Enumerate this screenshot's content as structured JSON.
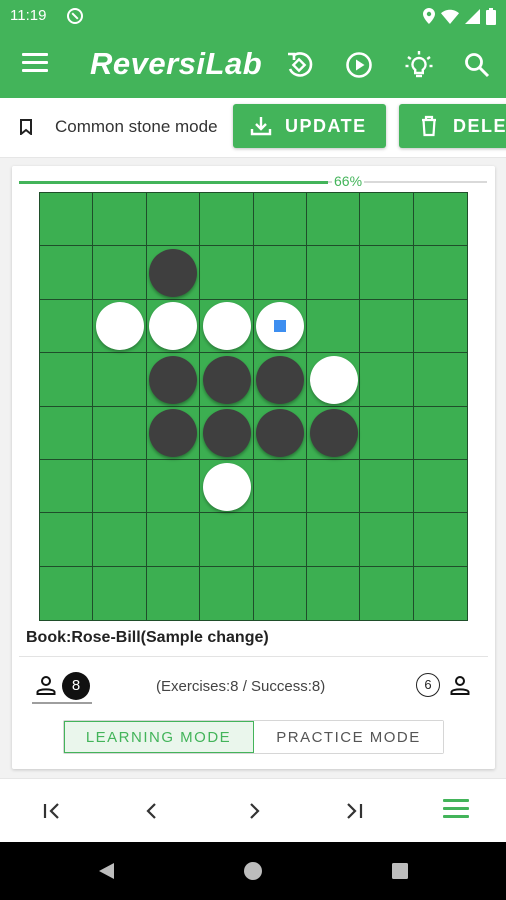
{
  "status_bar": {
    "time": "11:19"
  },
  "app_bar": {
    "title": "ReversiLab"
  },
  "action_row": {
    "mode_label": "Common stone mode",
    "update_label": "UPDATE",
    "delete_label": "DELETE"
  },
  "progress": {
    "value": 0.66,
    "label": "66%"
  },
  "board": {
    "size": 8,
    "stones": [
      {
        "row": 2,
        "col": 3,
        "color": "black"
      },
      {
        "row": 3,
        "col": 2,
        "color": "white"
      },
      {
        "row": 3,
        "col": 3,
        "color": "white"
      },
      {
        "row": 3,
        "col": 4,
        "color": "white"
      },
      {
        "row": 3,
        "col": 5,
        "color": "white",
        "marker": true
      },
      {
        "row": 4,
        "col": 3,
        "color": "black"
      },
      {
        "row": 4,
        "col": 4,
        "color": "black"
      },
      {
        "row": 4,
        "col": 5,
        "color": "black"
      },
      {
        "row": 4,
        "col": 6,
        "color": "white"
      },
      {
        "row": 5,
        "col": 3,
        "color": "black"
      },
      {
        "row": 5,
        "col": 4,
        "color": "black"
      },
      {
        "row": 5,
        "col": 5,
        "color": "black"
      },
      {
        "row": 5,
        "col": 6,
        "color": "black"
      },
      {
        "row": 6,
        "col": 4,
        "color": "white"
      }
    ]
  },
  "book": {
    "label": "Book:Rose-Bill(Sample change)"
  },
  "score": {
    "black_count": "8",
    "white_count": "6",
    "summary": "(Exercises:8 / Success:8)"
  },
  "modes": {
    "learning": "LEARNING MODE",
    "practice": "PRACTICE MODE"
  },
  "colors": {
    "accent": "#43b45a",
    "board": "#3caf51",
    "grid": "#1f4e2a",
    "hint": "#3d8ef0"
  }
}
